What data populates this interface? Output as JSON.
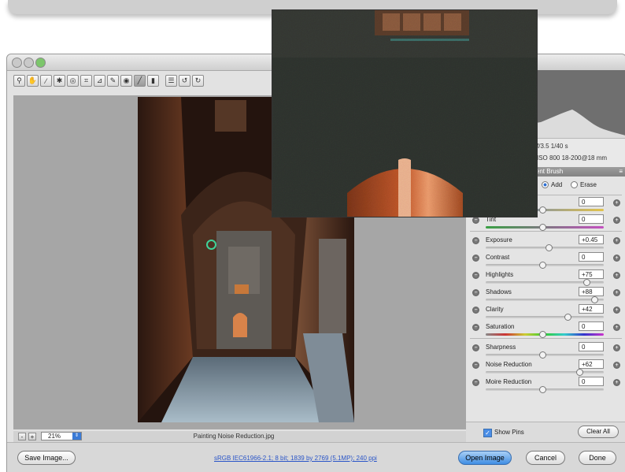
{
  "window": {
    "filename": "Painting Noise Reduction.jpg",
    "workflow_link": "sRGB IEC61966-2.1; 8 bit; 1839 by 2769 (5.1MP); 240 ppi"
  },
  "zoom": {
    "minus": "-",
    "plus": "+",
    "level": "21%"
  },
  "camera_info": {
    "line1": "f/3.5   1/40 s",
    "line2": "ISO 800   18-200@18 mm"
  },
  "panel": {
    "tool_title": "Adjustment Brush",
    "mode_add": "Add",
    "mode_erase": "Erase",
    "adjustments": [
      {
        "name": "",
        "value": "0",
        "level": 0.48
      },
      {
        "name": "Tint",
        "value": "0",
        "level": 0.48
      },
      {
        "name": "Exposure",
        "value": "+0.45",
        "level": 0.53
      },
      {
        "name": "Contrast",
        "value": "0",
        "level": 0.48
      },
      {
        "name": "Highlights",
        "value": "+75",
        "level": 0.85
      },
      {
        "name": "Shadows",
        "value": "+88",
        "level": 0.92
      },
      {
        "name": "Clarity",
        "value": "+42",
        "level": 0.69
      },
      {
        "name": "Saturation",
        "value": "0",
        "level": 0.48
      },
      {
        "name": "Sharpness",
        "value": "0",
        "level": 0.48
      },
      {
        "name": "Noise Reduction",
        "value": "+62",
        "level": 0.79
      },
      {
        "name": "Moire Reduction",
        "value": "0",
        "level": 0.48
      }
    ],
    "show_pins": "Show Pins",
    "clear_all": "Clear All"
  },
  "buttons": {
    "save_image": "Save Image...",
    "open_image": "Open Image",
    "cancel": "Cancel",
    "done": "Done"
  },
  "colors": {
    "accent": "#3f8ee3",
    "pin": "#3fd39a"
  }
}
